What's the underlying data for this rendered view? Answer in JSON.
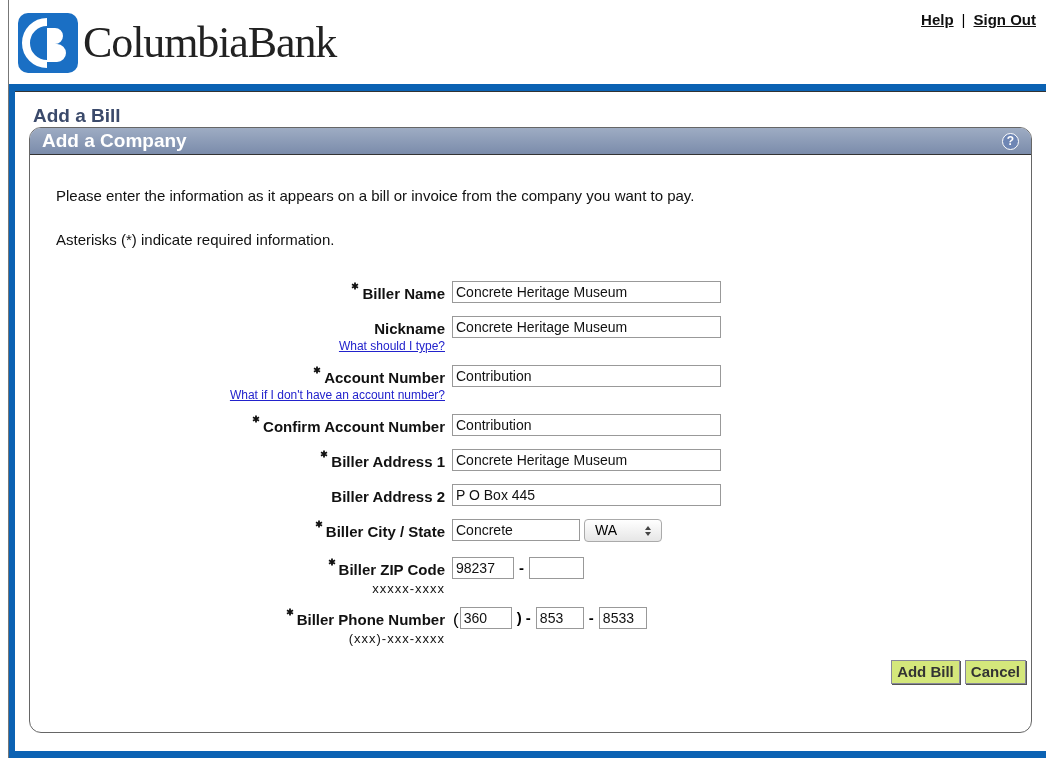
{
  "header": {
    "logo_text": "ColumbiaBank",
    "links": [
      {
        "label": "Help"
      },
      {
        "label": "Sign Out"
      }
    ],
    "separator": "|"
  },
  "page_title": "Add a Bill",
  "panel": {
    "title": "Add a Company",
    "help_icon": "?",
    "intro": "Please enter the information as it appears on a bill or invoice from the company you want to pay.",
    "note": "Asterisks (*) indicate required information.",
    "fields": [
      {
        "kind": "text",
        "label": "Biller Name",
        "required": true,
        "value": "Concrete Heritage Museum"
      },
      {
        "kind": "text",
        "label": "Nickname",
        "required": false,
        "value": "Concrete Heritage Museum",
        "help_link": "What should I type?"
      },
      {
        "kind": "text",
        "label": "Account Number",
        "required": true,
        "value": "Contribution",
        "help_link": "What if I don't have an account number?"
      },
      {
        "kind": "text",
        "label": "Confirm Account Number",
        "required": true,
        "value": "Contribution"
      },
      {
        "kind": "text",
        "label": "Biller Address 1",
        "required": true,
        "value": "Concrete Heritage Museum"
      },
      {
        "kind": "text",
        "label": "Biller Address 2",
        "required": false,
        "value": "P O Box 445"
      },
      {
        "kind": "city_state",
        "label": "Biller City / State",
        "required": true,
        "value": "Concrete",
        "state": "WA"
      },
      {
        "kind": "zip",
        "label": "Biller ZIP Code",
        "required": true,
        "value": "98237",
        "hint": "xxxxx-xxxx",
        "separator": "-"
      },
      {
        "kind": "phone",
        "label": "Biller Phone Number",
        "required": true,
        "area": "360",
        "prefix": "853",
        "line": "8533",
        "hint": "(xxx)-xxx-xxxx",
        "open": "(",
        "close": ")",
        "separator": "-"
      }
    ],
    "buttons": [
      {
        "label": "Add Bill"
      },
      {
        "label": "Cancel"
      }
    ]
  }
}
